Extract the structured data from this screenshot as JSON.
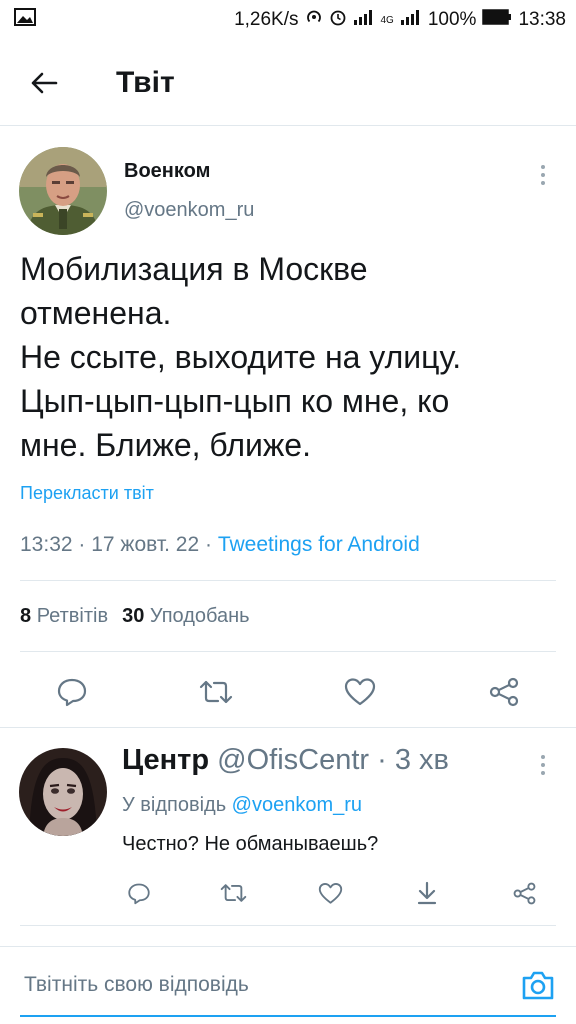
{
  "status_bar": {
    "speed": "1,26K/s",
    "battery": "100%",
    "time": "13:38",
    "network": "4G",
    "icons": [
      "image-icon",
      "hotspot-icon",
      "alarm-icon",
      "signal-icon",
      "battery-icon"
    ]
  },
  "app_bar": {
    "title": "Твіт",
    "back_icon": "arrow-left-icon"
  },
  "tweet": {
    "author_name": "Военком",
    "author_handle": "@voenkom_ru",
    "text_lines": [
      "Мобилизация в Москве",
      "отменена.",
      "Не ссыте, выходите на улицу.",
      "Цып-цып-цып-цып ко мне, ко",
      "мне. Ближе, ближе."
    ],
    "translate_label": "Перекласти твіт",
    "timestamp": "13:32 · 17 жовт. 22 · ",
    "client": "Tweetings for Android",
    "retweets_count": "8",
    "retweets_label": "Ретвітів",
    "likes_count": "30",
    "likes_label": "Уподобань",
    "actions": [
      "reply-icon",
      "retweet-icon",
      "like-icon",
      "share-icon"
    ]
  },
  "reply": {
    "name": "Центр",
    "handle": "@OfisCentr",
    "separator": " · ",
    "time": "3 хв",
    "reply_to_prefix": "У відповідь ",
    "reply_to_handle": "@voenkom_ru",
    "text": "Честно? Не обманываешь?",
    "actions": [
      "reply-icon",
      "retweet-icon",
      "like-icon",
      "download-icon",
      "share-icon"
    ]
  },
  "composer": {
    "placeholder": "Твітніть свою відповідь",
    "camera_icon": "camera-icon"
  },
  "colors": {
    "accent": "#1da1f2",
    "text": "#14171a",
    "muted": "#657786",
    "divider": "#e1e8ed"
  }
}
